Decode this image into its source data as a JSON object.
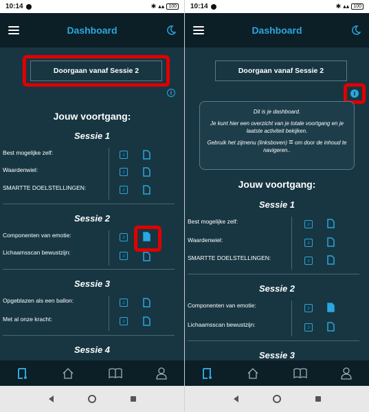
{
  "status": {
    "time": "10:14",
    "battery": "100"
  },
  "header": {
    "title": "Dashboard"
  },
  "continue_button": "Doorgaan vanaf Sessie 2",
  "info_symbol": "i",
  "progress_heading": "Jouw voortgang:",
  "tooltip": {
    "line1": "Dit is je dashboard.",
    "line2": "Je kunt hier een overzicht van je totale voortgang en je laatste activiteit bekijken.",
    "line3a": "Gebruik het zijmenu (linksboven)",
    "line3b": "om door de inhoud te navigeren.."
  },
  "sessions": [
    {
      "title": "Sessie 1",
      "items": [
        "Best mogelijke zelf:",
        "Waardenwiel:",
        "SMARTTE DOELSTELLINGEN:"
      ]
    },
    {
      "title": "Sessie 2",
      "items": [
        "Componenten van emotie:",
        "Lichaamsscan bewustzijn:"
      ]
    },
    {
      "title": "Sessie 3",
      "items": [
        "Opgeblazen als een ballon:",
        "Met al onze kracht:"
      ]
    },
    {
      "title": "Sessie 4",
      "items": []
    }
  ],
  "colors": {
    "accent": "#2aa7e0",
    "background": "#173642",
    "bar": "#0c1e26",
    "highlight": "#e00000"
  },
  "icons": {
    "music": "music-note-icon",
    "doc": "document-icon",
    "moon": "moon-icon"
  }
}
